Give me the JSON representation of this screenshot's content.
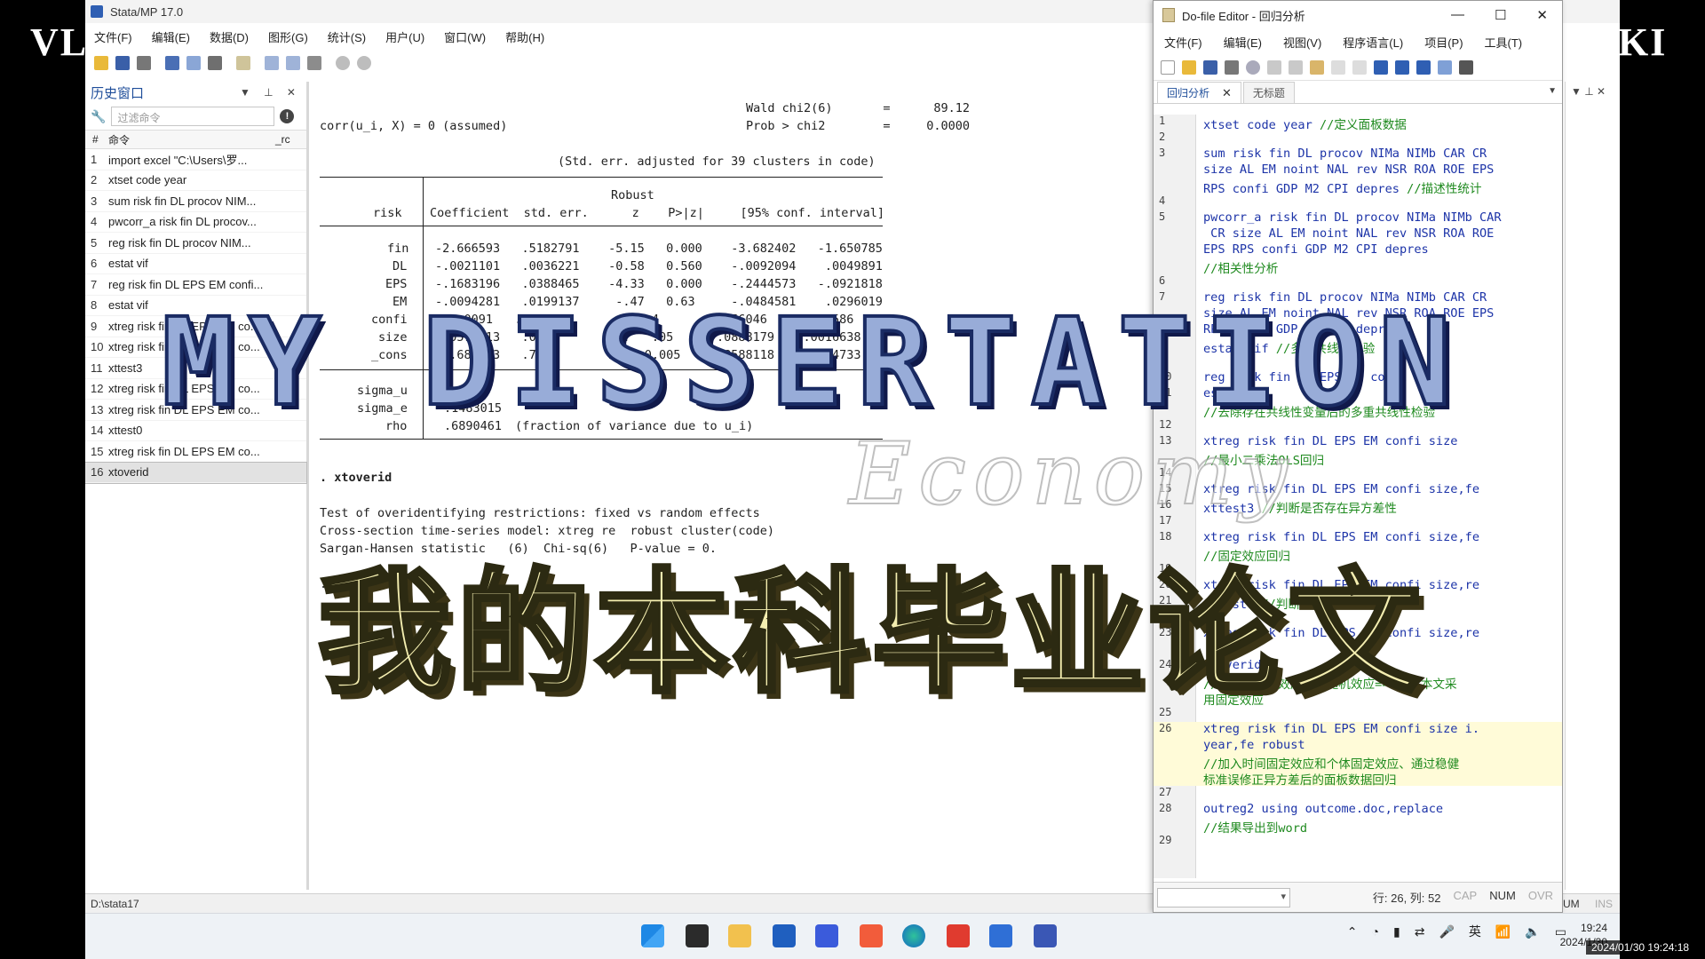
{
  "overlay": {
    "title": "MY DISSERTATION",
    "subtitle_cn": "我的本科毕业论文",
    "script_word": "Economy",
    "corner_left": "VL",
    "corner_right": "KI"
  },
  "stata": {
    "window_title": "Stata/MP 17.0",
    "menu": [
      "文件(F)",
      "编辑(E)",
      "数据(D)",
      "图形(G)",
      "统计(S)",
      "用户(U)",
      "窗口(W)",
      "帮助(H)"
    ],
    "status_path": "D:\\stata17",
    "history": {
      "title": "历史窗口",
      "filter_placeholder": "过滤命令",
      "col_num": "#",
      "col_cmd": "命令",
      "col_rc": "_rc",
      "items": [
        {
          "n": "1",
          "cmd": "import excel \"C:\\Users\\罗..."
        },
        {
          "n": "2",
          "cmd": "xtset code year"
        },
        {
          "n": "3",
          "cmd": "sum risk fin DL procov NIM..."
        },
        {
          "n": "4",
          "cmd": "pwcorr_a risk fin DL procov..."
        },
        {
          "n": "5",
          "cmd": "reg risk fin DL procov NIM..."
        },
        {
          "n": "6",
          "cmd": "estat vif"
        },
        {
          "n": "7",
          "cmd": "reg risk fin DL EPS EM confi..."
        },
        {
          "n": "8",
          "cmd": "estat vif"
        },
        {
          "n": "9",
          "cmd": "xtreg risk fin DL EPS EM co..."
        },
        {
          "n": "10",
          "cmd": "xtreg risk fin DL EPS EM co..."
        },
        {
          "n": "11",
          "cmd": "xttest3"
        },
        {
          "n": "12",
          "cmd": "xtreg risk fin DL EPS EM co..."
        },
        {
          "n": "13",
          "cmd": "xtreg risk fin DL EPS EM co..."
        },
        {
          "n": "14",
          "cmd": "xttest0"
        },
        {
          "n": "15",
          "cmd": "xtreg risk fin DL EPS EM co..."
        },
        {
          "n": "16",
          "cmd": "xtoverid"
        }
      ]
    },
    "results": {
      "wald_line": "Wald chi2(6)       =      89.12",
      "corr_line": "corr(u_i, X) = 0 (assumed)",
      "prob_line": "Prob > chi2        =     0.0000",
      "stderr_note": "(Std. err. adjusted for 39 clusters in code)",
      "robust_hdr": "Robust",
      "col_hdr_left": "risk",
      "col_hdr_right": "Coefficient  std. err.      z    P>|z|     [95% conf. interval]",
      "rows": [
        {
          "var": "fin",
          "vals": "-2.666593   .5182791    -5.15   0.000    -3.682402   -1.650785"
        },
        {
          "var": "DL",
          "vals": "-.0021101   .0036221    -0.58   0.560    -.0092094    .0049891"
        },
        {
          "var": "EPS",
          "vals": "-.1683196   .0388465    -4.33   0.000    -.2444573   -.0921818"
        },
        {
          "var": "EM",
          "vals": "-.0094281   .0199137     -.47   0.63     -.0484581    .0296019"
        },
        {
          "var": "confi",
          "vals": "   .0091   .0055         .   .4      -.0056046    .0225586"
        },
        {
          "var": "size",
          "vals": "-.0577713   .0279         .   .05     -.0888179    .0016638"
        },
        {
          "var": "_cons",
          "vals": " 2.685773   .7546       2.   0.005     .8588118    4.514733"
        }
      ],
      "sigma_u_label": "sigma_u",
      "sigma_u_val": "-2.4",
      "sigma_e_label": "sigma_e",
      "sigma_e_val": ".1483015",
      "rho_label": "rho",
      "rho_val": ".6890461",
      "rho_note": "(fraction of variance due to u_i)",
      "cmd_echo": ". xtoverid",
      "test_line1": "Test of overidentifying restrictions: fixed vs random effects",
      "test_line2": "Cross-section time-series model: xtreg re  robust cluster(code)",
      "test_line3": "Sargan-Hansen statistic   (6)  Chi-sq(6)   P-value = 0.",
      "prompt": "."
    }
  },
  "dofile": {
    "window_title": "Do-file Editor - 回归分析",
    "menu": [
      "文件(F)",
      "编辑(E)",
      "视图(V)",
      "程序语言(L)",
      "项目(P)",
      "工具(T)"
    ],
    "tabs": [
      {
        "label": "回归分析",
        "active": true
      },
      {
        "label": "无标题",
        "active": false
      }
    ],
    "lines": [
      {
        "ln": "1",
        "code": "xtset code year ",
        "comment": "//定义面板数据"
      },
      {
        "ln": "2",
        "code": "",
        "comment": ""
      },
      {
        "ln": "3",
        "code": "sum risk fin DL procov NIMa NIMb CAR CR",
        "comment": ""
      },
      {
        "ln": "",
        "code": "size AL EM noint NAL rev NSR ROA ROE EPS",
        "comment": ""
      },
      {
        "ln": "",
        "code": "RPS confi GDP M2 CPI depres ",
        "comment": "//描述性统计"
      },
      {
        "ln": "4",
        "code": "",
        "comment": ""
      },
      {
        "ln": "5",
        "code": "pwcorr_a risk fin DL procov NIMa NIMb CAR",
        "comment": ""
      },
      {
        "ln": "",
        "code": " CR size AL EM noint NAL rev NSR ROA ROE",
        "comment": ""
      },
      {
        "ln": "",
        "code": "EPS RPS confi GDP M2 CPI depres",
        "comment": ""
      },
      {
        "ln": "",
        "code": "",
        "comment": "//相关性分析"
      },
      {
        "ln": "6",
        "code": "",
        "comment": ""
      },
      {
        "ln": "7",
        "code": "reg risk fin DL procov NIMa NIMb CAR CR",
        "comment": ""
      },
      {
        "ln": "",
        "code": "size AL EM noint NAL rev NSR ROA ROE EPS",
        "comment": ""
      },
      {
        "ln": "",
        "code": "RPS confi GDP M2 CPI depres",
        "comment": ""
      },
      {
        "ln": "8",
        "code": "estat vif ",
        "comment": "//多重共线性检验"
      },
      {
        "ln": "9",
        "code": "",
        "comment": ""
      },
      {
        "ln": "10",
        "code": "reg risk fin DL EPS EM confi size",
        "comment": ""
      },
      {
        "ln": "11",
        "code": "estat vif",
        "comment": ""
      },
      {
        "ln": "",
        "code": "",
        "comment": "//去除存在共线性变量后的多重共线性检验"
      },
      {
        "ln": "12",
        "code": "",
        "comment": ""
      },
      {
        "ln": "13",
        "code": "xtreg risk fin DL EPS EM confi size",
        "comment": ""
      },
      {
        "ln": "",
        "code": "",
        "comment": "//最小二乘法OLS回归"
      },
      {
        "ln": "14",
        "code": "",
        "comment": ""
      },
      {
        "ln": "15",
        "code": "xtreg risk fin DL EPS EM confi size,fe",
        "comment": ""
      },
      {
        "ln": "16",
        "code": "xttest3 ",
        "comment": "//判断是否存在异方差性"
      },
      {
        "ln": "17",
        "code": "",
        "comment": ""
      },
      {
        "ln": "18",
        "code": "xtreg risk fin DL EPS EM confi size,fe",
        "comment": ""
      },
      {
        "ln": "",
        "code": "",
        "comment": "//固定效应回归"
      },
      {
        "ln": "19",
        "code": "",
        "comment": ""
      },
      {
        "ln": "20",
        "code": "xtreg risk fin DL EPS EM confi size,re",
        "comment": ""
      },
      {
        "ln": "21",
        "code": "xttest0 ",
        "comment": "//判断随机效应是否优于OLS"
      },
      {
        "ln": "22",
        "code": "",
        "comment": ""
      },
      {
        "ln": "23",
        "code": "xtreg risk fin DL EPS EM confi size,re",
        "comment": ""
      },
      {
        "ln": "",
        "code": "",
        "comment": ""
      },
      {
        "ln": "24",
        "code": "xtoverid",
        "comment": ""
      },
      {
        "ln": "",
        "code": "",
        "comment": "//判断用固定效应还是随机效应==>决定本文采"
      },
      {
        "ln": "",
        "code": "",
        "comment": "用固定效应"
      },
      {
        "ln": "25",
        "code": "",
        "comment": ""
      },
      {
        "ln": "26",
        "code": "xtreg risk fin DL EPS EM confi size i.",
        "comment": ""
      },
      {
        "ln": "",
        "code": "year,fe robust",
        "comment": ""
      },
      {
        "ln": "",
        "code": "",
        "comment": "//加入时间固定效应和个体固定效应、通过稳健"
      },
      {
        "ln": "",
        "code": "",
        "comment": "标准误修正异方差后的面板数据回归"
      },
      {
        "ln": "27",
        "code": "",
        "comment": ""
      },
      {
        "ln": "28",
        "code": "outreg2 using outcome.doc,replace",
        "comment": ""
      },
      {
        "ln": "",
        "code": "",
        "comment": "//结果导出到word"
      },
      {
        "ln": "29",
        "code": "",
        "comment": ""
      }
    ],
    "status": {
      "position": "行: 26, 列: 52",
      "cap": "CAP",
      "num": "NUM",
      "ovr": "OVR"
    }
  },
  "taskbar": {
    "ime": "英",
    "time": "19:24",
    "date": "2024/1/30",
    "stamp": "2024/01/30 19:24:18",
    "right_status_num": "UM",
    "right_status_ins": "INS"
  }
}
